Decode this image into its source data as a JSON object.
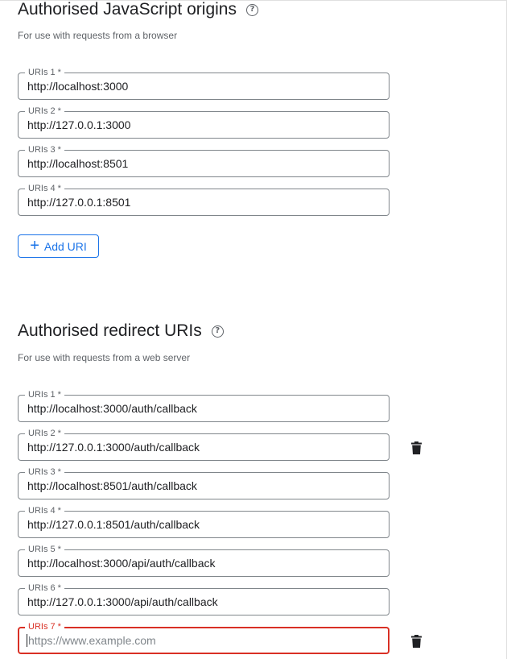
{
  "js_origins": {
    "title": "Authorised JavaScript origins",
    "subtitle": "For use with requests from a browser",
    "fields": [
      {
        "label": "URIs 1 *",
        "value": "http://localhost:3000"
      },
      {
        "label": "URIs 2 *",
        "value": "http://127.0.0.1:3000"
      },
      {
        "label": "URIs 3 *",
        "value": "http://localhost:8501"
      },
      {
        "label": "URIs 4 *",
        "value": "http://127.0.0.1:8501"
      }
    ],
    "add_button_label": "Add URI"
  },
  "redirect_uris": {
    "title": "Authorised redirect URIs",
    "subtitle": "For use with requests from a web server",
    "fields": [
      {
        "label": "URIs 1 *",
        "value": "http://localhost:3000/auth/callback"
      },
      {
        "label": "URIs 2 *",
        "value": "http://127.0.0.1:3000/auth/callback"
      },
      {
        "label": "URIs 3 *",
        "value": "http://localhost:8501/auth/callback"
      },
      {
        "label": "URIs 4 *",
        "value": "http://127.0.0.1:8501/auth/callback"
      },
      {
        "label": "URIs 5 *",
        "value": "http://localhost:3000/api/auth/callback"
      },
      {
        "label": "URIs 6 *",
        "value": "http://127.0.0.1:3000/api/auth/callback"
      },
      {
        "label": "URIs 7 *",
        "value": "",
        "placeholder": "https://www.example.com"
      }
    ]
  },
  "colors": {
    "accent": "#1a73e8",
    "error": "#d93025",
    "border": "#80868b",
    "text": "#202124",
    "muted": "#5f6368"
  },
  "icons": {
    "help": "help-circle-icon",
    "add": "plus-icon",
    "delete": "trash-icon"
  }
}
